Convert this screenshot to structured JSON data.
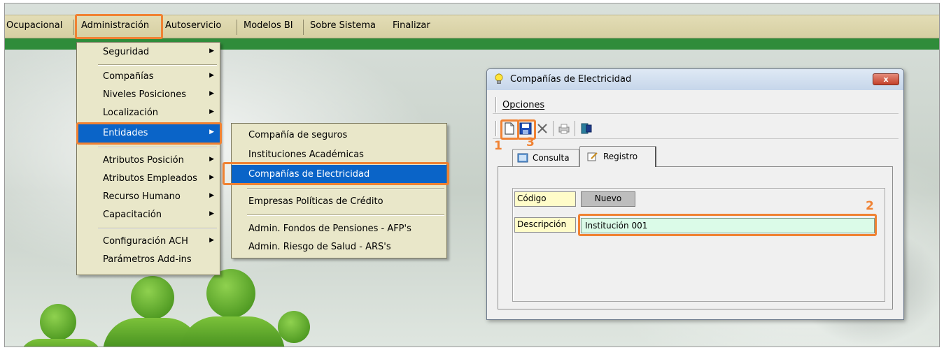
{
  "menubar": {
    "items": [
      "Ocupacional",
      "Administración",
      "Autoservicio",
      "Modelos BI",
      "Sobre Sistema",
      "Finalizar"
    ]
  },
  "admin_menu": {
    "items": [
      {
        "label": "Seguridad",
        "submenu": true
      },
      {
        "label": "Compañías",
        "submenu": true
      },
      {
        "label": "Niveles Posiciones",
        "submenu": true
      },
      {
        "label": "Localización",
        "submenu": true
      },
      {
        "label": "Entidades",
        "submenu": true,
        "selected": true
      },
      {
        "label": "Atributos Posición",
        "submenu": true
      },
      {
        "label": "Atributos Empleados",
        "submenu": true
      },
      {
        "label": "Recurso Humano",
        "submenu": true
      },
      {
        "label": "Capacitación",
        "submenu": true
      },
      {
        "label": "Configuración ACH",
        "submenu": true
      },
      {
        "label": "Parámetros Add-ins",
        "submenu": false
      }
    ]
  },
  "entidades_menu": {
    "items": [
      "Compañía de seguros",
      "Instituciones Académicas",
      "Compañías de Electricidad",
      "Empresas Políticas de Crédito",
      "Admin. Fondos de Pensiones - AFP's",
      "Admin. Riesgo de Salud - ARS's"
    ],
    "selected": "Compañías de Electricidad"
  },
  "dialog": {
    "title": "Compañías de Electricidad",
    "close_label": "x",
    "menu_label": "Opciones",
    "tabs": [
      "Consulta",
      "Registro"
    ],
    "active_tab": "Registro",
    "fields": {
      "codigo_label": "Código",
      "codigo_value": "Nuevo",
      "descripcion_label": "Descripción",
      "descripcion_value": "Institución 001"
    },
    "toolbar_icons": [
      "new-document-icon",
      "save-icon",
      "delete-icon",
      "print-icon",
      "exit-icon"
    ]
  },
  "annotations": {
    "new": "1",
    "field": "2",
    "save": "3"
  },
  "colors": {
    "highlight": "#f08233",
    "selection": "#0a64c8",
    "menubar": "#d6cfa2",
    "brand_green": "#2f8c3a"
  }
}
